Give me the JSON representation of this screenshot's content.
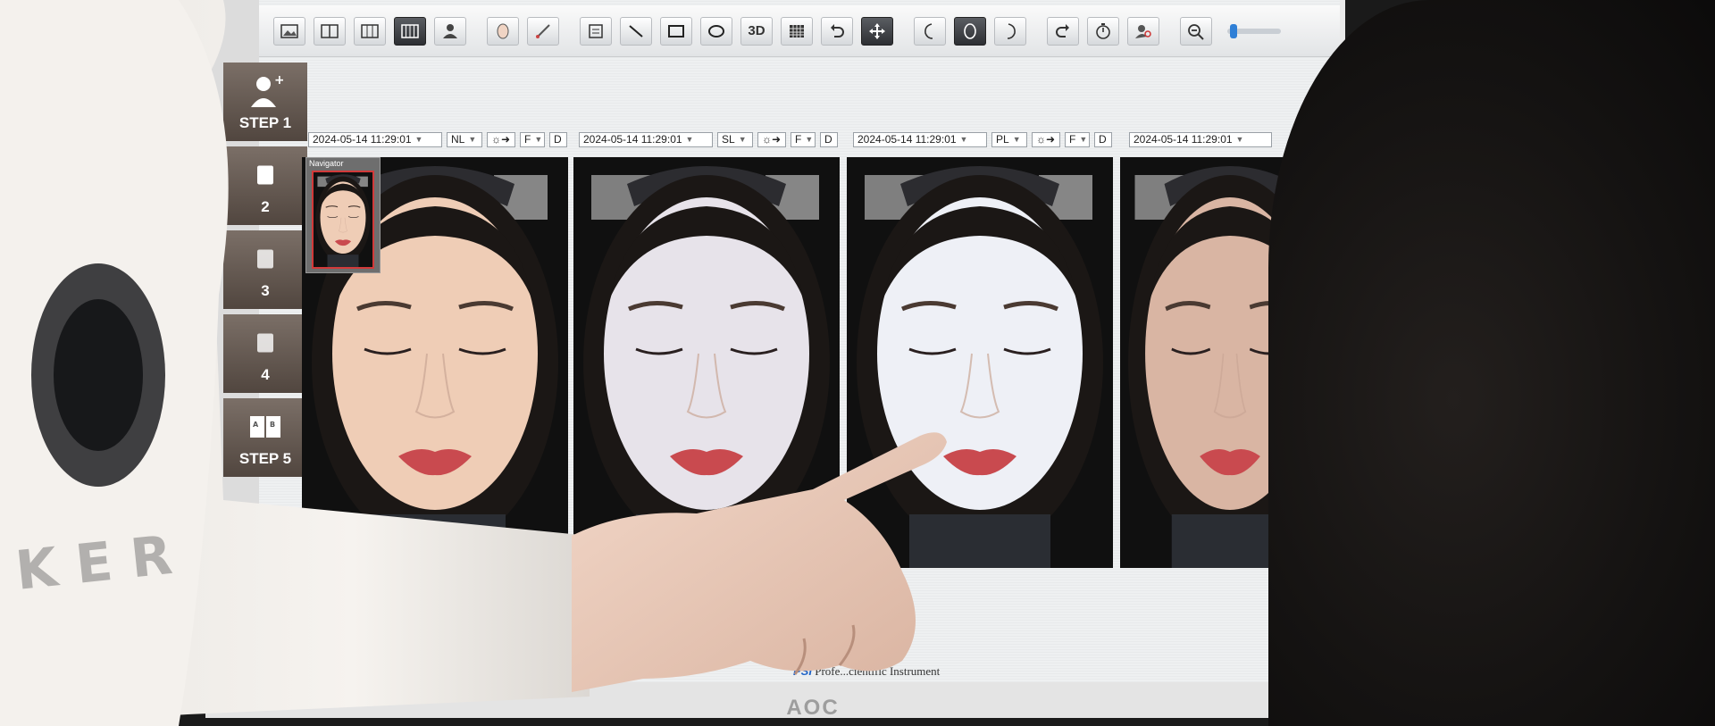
{
  "toolbar": {
    "tools": [
      "image-icon",
      "split2-icon",
      "split3-icon",
      "split4-icon",
      "person-icon",
      "face-icon",
      "brush-icon",
      "note-icon",
      "line-icon",
      "rectangle-icon",
      "ellipse-icon",
      "3d-icon",
      "grid-icon",
      "undo-icon",
      "move-icon",
      "face-left-icon",
      "face-front-icon",
      "face-right-icon",
      "redo-icon",
      "timer-icon",
      "search-person-icon",
      "zoom-out-icon"
    ],
    "label_3d": "3D",
    "zoom_fraction": 0.05
  },
  "steps": [
    {
      "label": "STEP 1",
      "icon": "add-person-icon"
    },
    {
      "label": "2",
      "icon": "step-icon"
    },
    {
      "label": "3",
      "icon": "step-icon"
    },
    {
      "label": "4",
      "icon": "step-icon"
    },
    {
      "label": "STEP 5",
      "icon": "book-icon"
    }
  ],
  "navigator": {
    "title": "Navigator"
  },
  "captures": [
    {
      "timestamp": "2024-05-14 11:29:01",
      "mode": "NL",
      "view": "F",
      "extra": "D",
      "skin": "#efcdb6"
    },
    {
      "timestamp": "2024-05-14 11:29:01",
      "mode": "SL",
      "view": "F",
      "extra": "D",
      "skin": "#e7e3ea"
    },
    {
      "timestamp": "2024-05-14 11:29:01",
      "mode": "PL",
      "view": "F",
      "extra": "D",
      "skin": "#eef0f6"
    },
    {
      "timestamp": "2024-05-14 11:29:01",
      "mode": "",
      "view": "",
      "extra": "",
      "skin": "#d9b5a3"
    }
  ],
  "footer": {
    "brand": "PSI",
    "text": " Profe...cientific Instrument"
  },
  "monitor_brand": "AOC",
  "colors": {
    "accent": "#2f7fd6",
    "lip": "#c94a4f"
  }
}
